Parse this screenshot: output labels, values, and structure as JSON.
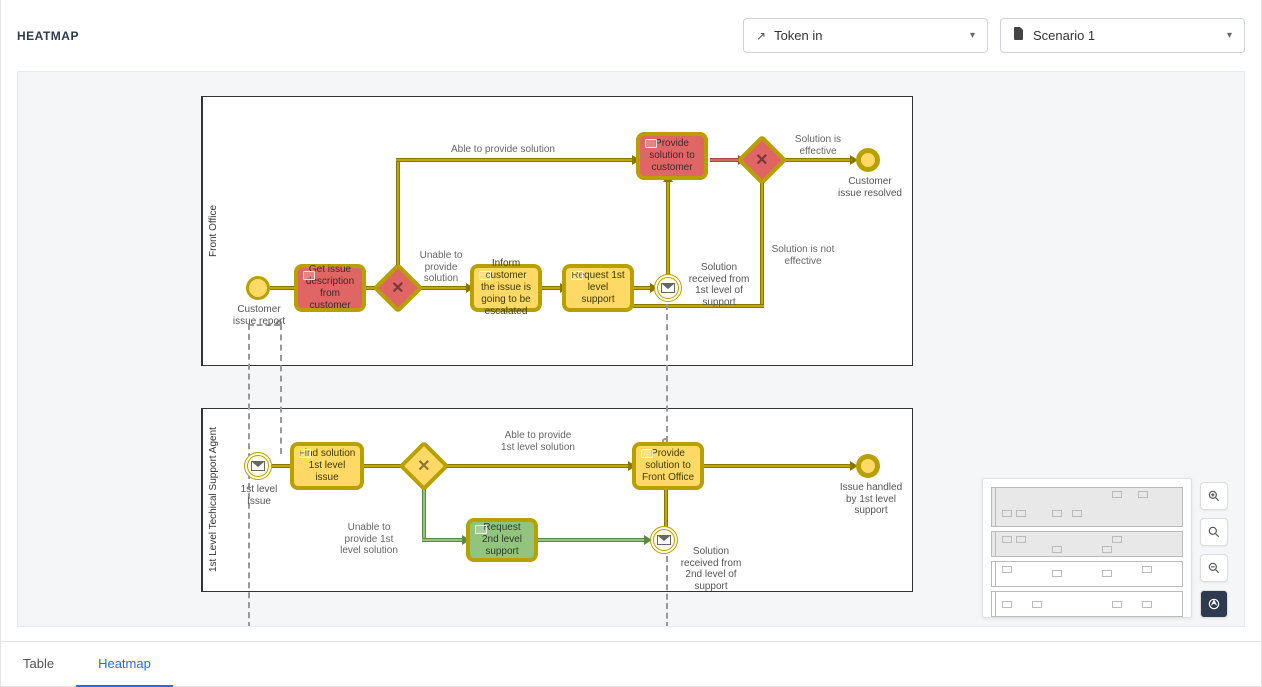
{
  "header": {
    "title": "HEATMAP",
    "dropdown1": {
      "icon": "↗",
      "label": "Token in"
    },
    "dropdown2": {
      "icon": "file",
      "label": "Scenario 1"
    }
  },
  "pools": {
    "front_office": {
      "label": "Front Office"
    },
    "level1": {
      "label": "1st Level Techical Support Agent"
    }
  },
  "nodes": {
    "start1_label": "Customer issue report",
    "task_get_issue": "Get issue description from customer",
    "task_inform": "Inform customer the issue is going to be escalated",
    "task_request_l1": "Request 1st level support",
    "task_provide_customer": "Provide solution to customer",
    "end1_label": "Customer issue resolved",
    "msg1_label": "Solution received from 1st level of support",
    "start2_label": "1st level Issue",
    "task_find": "Find solution 1st level issue",
    "task_provide_fo": "Provide solution to Front Office",
    "task_request_l2": "Request 2nd level support",
    "end2_label": "Issue handled by 1st level support",
    "msg2_label": "Solution received from 2nd level of support"
  },
  "edges": {
    "able_provide": "Able to  provide solution",
    "unable_provide": "Unable to provide solution",
    "solution_effective": "Solution is effective",
    "solution_not_effective": "Solution is not effective",
    "able_l1": "Able to provide  1st level solution",
    "unable_l1": "Unable to provide 1st level solution"
  },
  "zoom": {
    "zoom_in": "zoom-in",
    "zoom_reset": "zoom-reset",
    "zoom_out": "zoom-out",
    "fit": "fit"
  },
  "tabs": {
    "table": "Table",
    "heatmap": "Heatmap"
  },
  "colors": {
    "heat_high": "#e06666",
    "heat_med": "#ffd966",
    "heat_low": "#93c47d",
    "flow": "#c0a800"
  }
}
